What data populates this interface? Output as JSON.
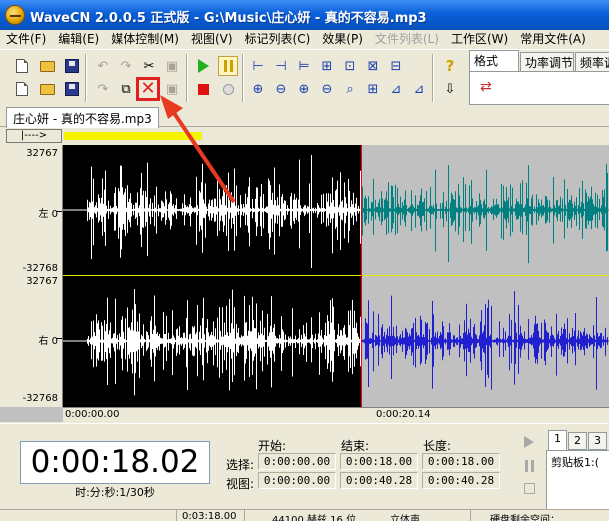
{
  "window": {
    "title": "WaveCN 2.0.0.5 正式版 - G:\\Music\\庄心妍 - 真的不容易.mp3"
  },
  "menu": [
    {
      "label": "文件(F)",
      "enabled": true
    },
    {
      "label": "编辑(E)",
      "enabled": true
    },
    {
      "label": "媒体控制(M)",
      "enabled": true
    },
    {
      "label": "视图(V)",
      "enabled": true
    },
    {
      "label": "标记列表(C)",
      "enabled": true
    },
    {
      "label": "效果(P)",
      "enabled": true
    },
    {
      "label": "文件列表(L)",
      "enabled": false
    },
    {
      "label": "工作区(W)",
      "enabled": true
    },
    {
      "label": "常用文件(A)",
      "enabled": true
    }
  ],
  "panel_tabs": [
    "格式",
    "功率调节",
    "频率调"
  ],
  "document_tab": "庄心妍 - 真的不容易.mp3",
  "navigator_button": "|---->",
  "scale": {
    "top_channel": {
      "max": "32767",
      "label": "左 0",
      "min": "-32768"
    },
    "bottom_channel": {
      "max": "32767",
      "label": "右 0",
      "min": "-32768"
    }
  },
  "ruler": {
    "start": "0:00:00.00",
    "mid": "0:00:20.14"
  },
  "waveform": {
    "cursor_fraction": 0.546
  },
  "position": {
    "current_time": "0:00:18.02",
    "time_format": "时:分:秒:1/30秒"
  },
  "range_table": {
    "headers": {
      "start": "开始:",
      "end": "结束:",
      "length": "长度:"
    },
    "rows": [
      {
        "label": "选择:",
        "start": "0:00:00.00",
        "end": "0:00:18.00",
        "length": "0:00:18.00"
      },
      {
        "label": "视图:",
        "start": "0:00:00.00",
        "end": "0:00:40.28",
        "length": "0:00:40.28"
      }
    ]
  },
  "clipboard": {
    "tabs": [
      "1",
      "2",
      "3"
    ],
    "label": "剪贴板1:("
  },
  "status": {
    "duration": "0:03:18.00",
    "format": "44100 赫兹  16 位",
    "channels": "立体声",
    "disk": "硬盘剩余空间："
  },
  "colors": {
    "selection_bg": "#000000",
    "wave_selected": "#ffffff",
    "wave_left_unselected": "#008080",
    "wave_right_unselected": "#2020d0",
    "unselected_bg": "#c0c0c0",
    "cursor": "#ff0000",
    "highlight": "#e02020"
  }
}
